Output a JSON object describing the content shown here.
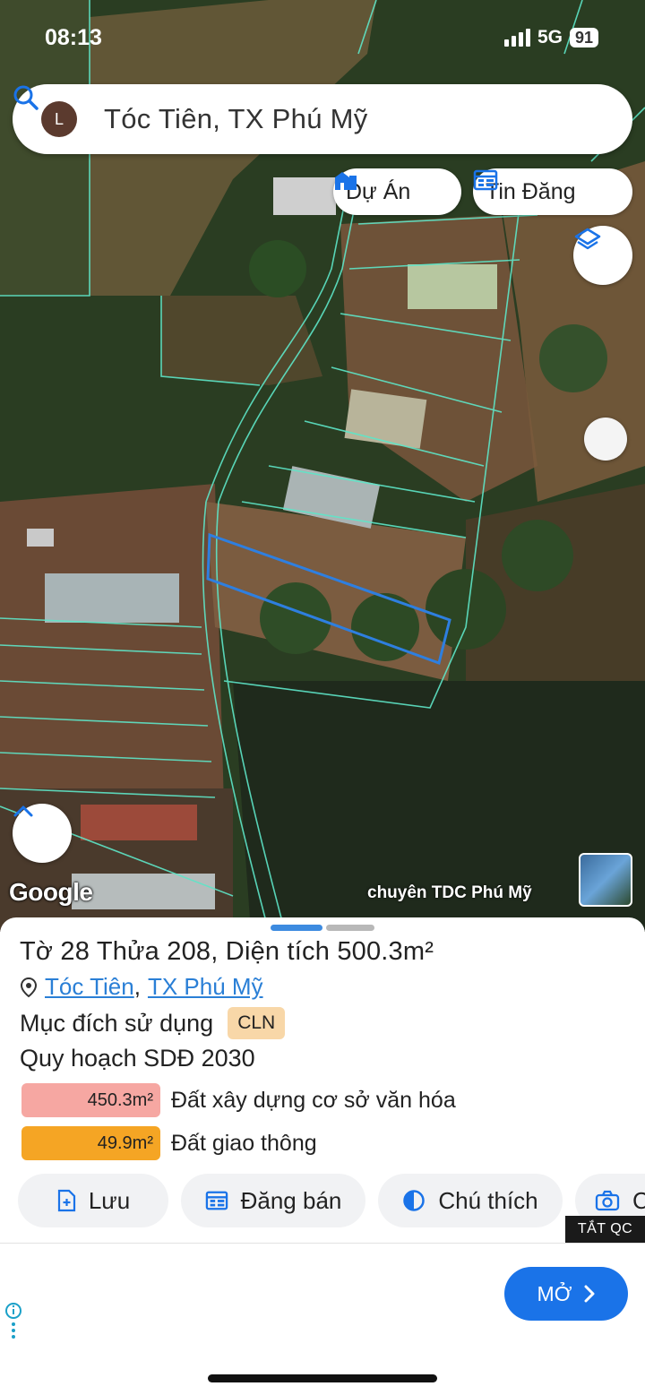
{
  "status_bar": {
    "time": "08:13",
    "network": "5G",
    "battery": "91"
  },
  "search": {
    "avatar_letter": "L",
    "query": "Tóc Tiên, TX Phú Mỹ"
  },
  "map_chips": {
    "projects_label": "Dự Án",
    "listings_label": "Tin Đăng"
  },
  "map": {
    "provider": "Google",
    "watermark": "chuyên TDC Phú Mỹ",
    "parcel_outline_color": "#2e7fe0",
    "boundary_color": "#5ee6c8"
  },
  "parcel": {
    "title_prefix": "Tờ",
    "sheet_no": "28",
    "plot_prefix": "Thửa",
    "plot_no": "208",
    "area_prefix": "Diện tích",
    "area_value": "500.3",
    "area_unit": "m²",
    "commune": "Tóc Tiên",
    "town": "TX Phú Mỹ",
    "purpose_label": "Mục đích sử dụng",
    "purpose_code": "CLN",
    "plan_title": "Quy hoạch SDĐ 2030",
    "plans": [
      {
        "area": "450.3m²",
        "label": "Đất xây dựng cơ sở văn hóa",
        "color": "#f6a7a2"
      },
      {
        "area": "49.9m²",
        "label": "Đất giao thông",
        "color": "#f5a524"
      }
    ]
  },
  "actions": {
    "save": "Lưu",
    "sell": "Đăng bán",
    "legend": "Chú thích",
    "capture": "C"
  },
  "ad": {
    "close_label": "TẮT QC",
    "open_label": "MỞ"
  }
}
